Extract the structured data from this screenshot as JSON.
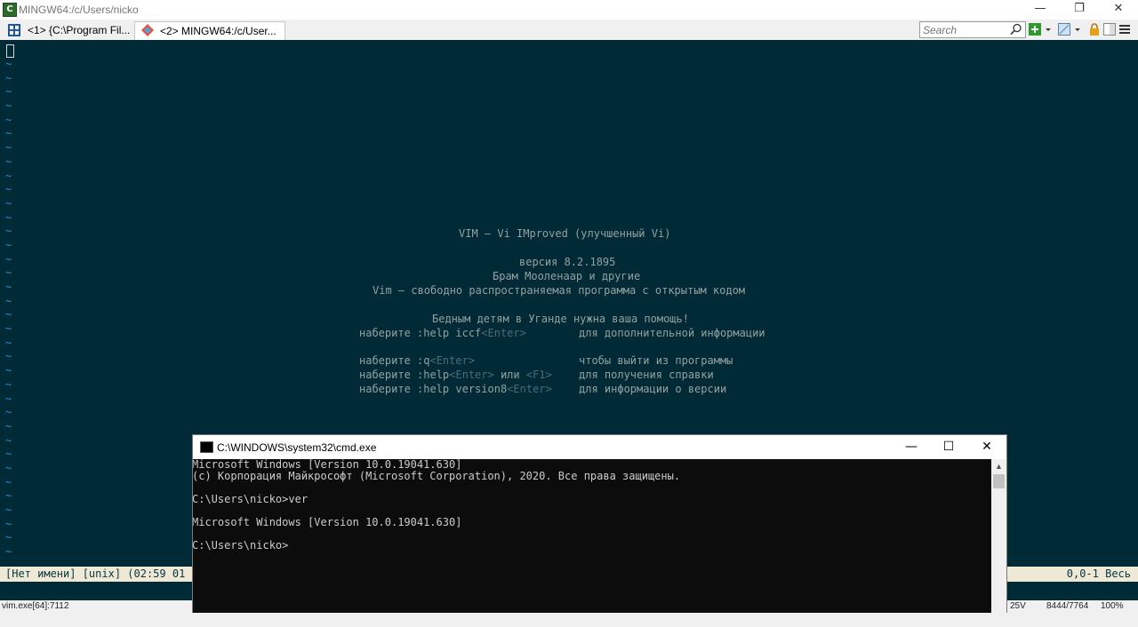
{
  "window": {
    "title": "MINGW64:/c/Users/nicko",
    "minimize": "—",
    "restore": "❐",
    "close": "✕"
  },
  "tabs": [
    {
      "label": "<1> {C:\\Program Fil..."
    },
    {
      "label": "<2> MINGW64:/c/User..."
    }
  ],
  "search": {
    "placeholder": "Search"
  },
  "vim": {
    "tilde": "~",
    "intro": {
      "title": "VIM — Vi IMproved (улучшенный Vi)",
      "version": "версия 8.2.1895",
      "author": "Брам Мооленаар и другие",
      "license": "Vim — свободно распространяемая программа с открытым кодом",
      "uganda": "Бедным детям в Уганде нужна ваша помощь!",
      "iccf_cmd": "наберите :help iccf",
      "iccf_key": "<Enter>",
      "iccf_desc": "для дополнительной информации",
      "quit_cmd": "наберите :q",
      "quit_key": "<Enter>",
      "quit_desc": "чтобы выйти из программы",
      "help_cmd": "наберите :help",
      "help_key": "<Enter>",
      "help_or": " или ",
      "help_f1": "<F1>",
      "help_desc": "для получения справки",
      "ver_cmd": "наберите :help version8",
      "ver_key": "<Enter>",
      "ver_desc": "для информации о версии"
    },
    "statusline": {
      "left": "[Нет имени] [unix] (02:59 01",
      "right": "0,0-1 Весь"
    }
  },
  "statusbar": {
    "process": "vim.exe[64]:7112",
    "mid": "25V",
    "pos": "8444/7764",
    "zoom": "100%"
  },
  "cmd": {
    "title": "C:\\WINDOWS\\system32\\cmd.exe",
    "lines": [
      "Microsoft Windows [Version 10.0.19041.630]",
      "(c) Корпорация Майкрософт (Microsoft Corporation), 2020. Все права защищены.",
      "",
      "C:\\Users\\nicko>ver",
      "",
      "Microsoft Windows [Version 10.0.19041.630]",
      "",
      "C:\\Users\\nicko>"
    ]
  }
}
